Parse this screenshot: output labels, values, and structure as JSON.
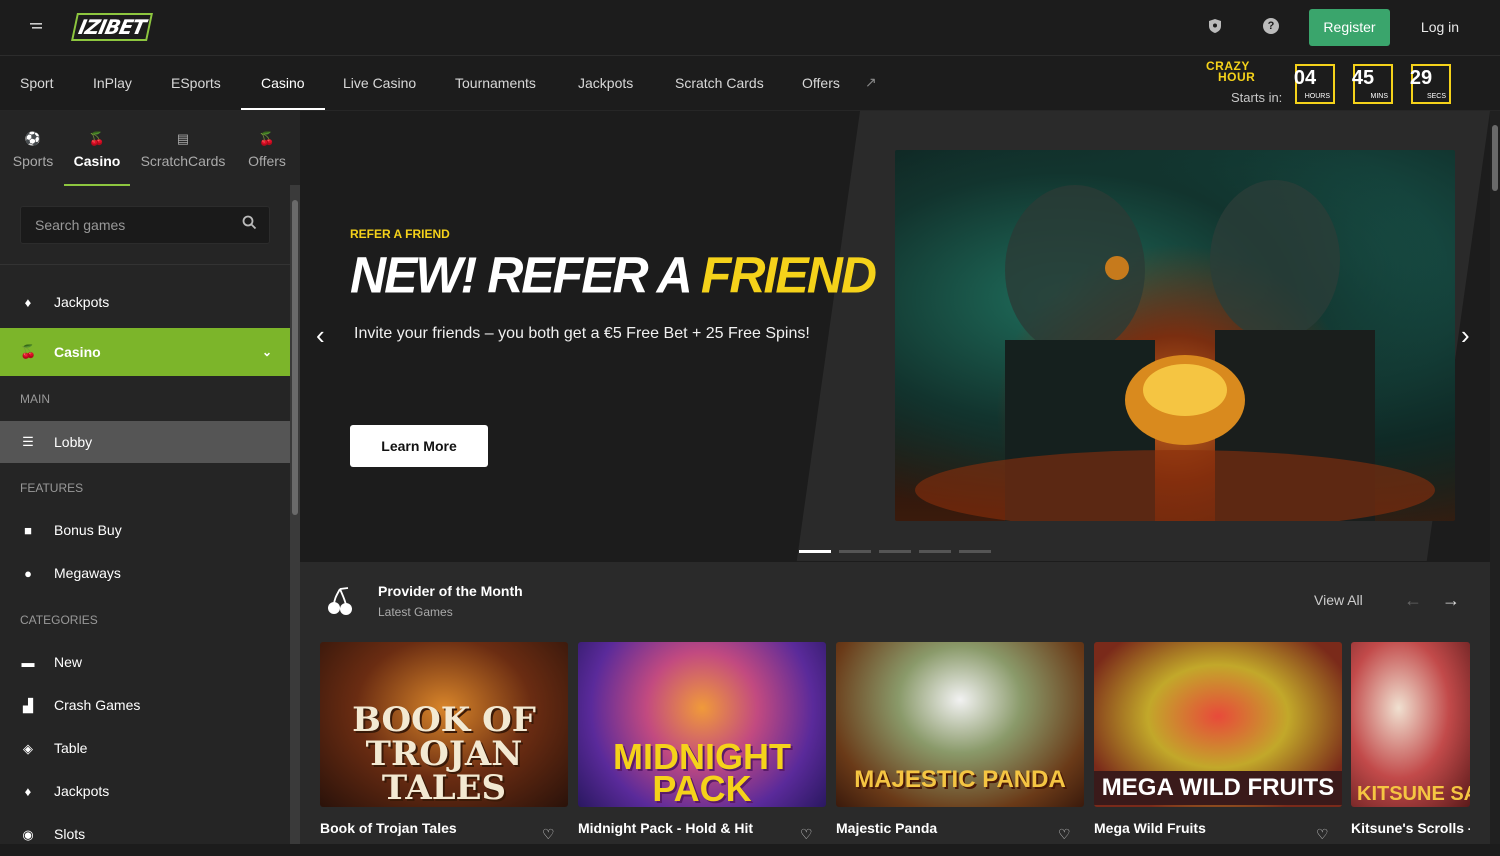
{
  "header": {
    "logo_text": "IZIBET",
    "register_label": "Register",
    "login_label": "Log in"
  },
  "nav": {
    "items": [
      "Sport",
      "InPlay",
      "ESports",
      "Casino",
      "Live Casino",
      "Tournaments",
      "Jackpots",
      "Scratch Cards",
      "Offers"
    ],
    "active": "Casino"
  },
  "crazy_hour": {
    "title_line1": "CRAZY",
    "title_line2": "HOUR",
    "starts_label": "Starts in:",
    "hours": "04",
    "hours_unit": "HOURS",
    "mins": "45",
    "mins_unit": "MINS",
    "secs": "29",
    "secs_unit": "SECS"
  },
  "sidebar": {
    "tabs": [
      "Sports",
      "Casino",
      "ScratchCards",
      "Offers"
    ],
    "search_placeholder": "Search games",
    "jackpots": "Jackpots",
    "casino": "Casino",
    "main_heading": "MAIN",
    "lobby": "Lobby",
    "features_heading": "FEATURES",
    "bonus_buy": "Bonus Buy",
    "megaways": "Megaways",
    "categories_heading": "CATEGORIES",
    "new": "New",
    "crash_games": "Crash Games",
    "table": "Table",
    "jackpots2": "Jackpots",
    "slots": "Slots"
  },
  "hero": {
    "kicker": "REFER A FRIEND",
    "title_part1": "NEW! REFER A ",
    "title_part2": "FRIEND",
    "subtitle": "Invite your friends – you both get a €5 Free Bet + 25 Free Spins!",
    "cta": "Learn More",
    "slide_count": 5,
    "active_slide": 1
  },
  "provider": {
    "title": "Provider of the Month",
    "subtitle": "Latest Games",
    "view_all": "View All",
    "games": [
      {
        "name": "Book of Trojan Tales",
        "art": "BOOK OF TROJAN TALES"
      },
      {
        "name": "Midnight Pack - Hold & Hit",
        "art": "MIDNIGHT PACK"
      },
      {
        "name": "Majestic Panda",
        "art": "MAJESTIC PANDA"
      },
      {
        "name": "Mega Wild Fruits",
        "art": "MEGA WILD FRUITS"
      },
      {
        "name": "Kitsune's Scrolls - S",
        "art": "KITSUNE SACRED"
      }
    ]
  },
  "colors": {
    "accent_green": "#7cb52a",
    "register_green": "#3aa56c",
    "yellow": "#f5d21a"
  }
}
